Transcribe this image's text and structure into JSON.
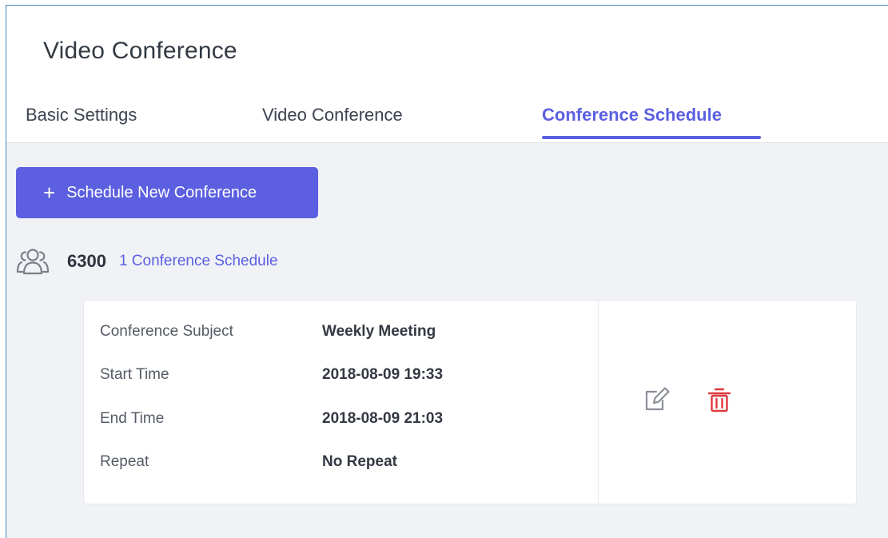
{
  "page": {
    "title": "Video Conference"
  },
  "tabs": [
    {
      "label": "Basic Settings",
      "active": false
    },
    {
      "label": "Video Conference",
      "active": false
    },
    {
      "label": "Conference Schedule",
      "active": true
    }
  ],
  "toolbar": {
    "new_button_icon": "plus-icon",
    "new_button_label": "Schedule New Conference"
  },
  "room": {
    "icon": "conference-users-icon",
    "number": "6300",
    "schedule_count_label": "1 Conference Schedule"
  },
  "schedule": {
    "rows": [
      {
        "label": "Conference Subject",
        "value": "Weekly Meeting"
      },
      {
        "label": "Start Time",
        "value": "2018-08-09 19:33"
      },
      {
        "label": "End Time",
        "value": "2018-08-09 21:03"
      },
      {
        "label": "Repeat",
        "value": "No Repeat"
      }
    ],
    "actions": {
      "edit_icon": "edit-icon",
      "delete_icon": "trash-icon"
    }
  },
  "colors": {
    "accent": "#5b5fe0",
    "delete": "#e0393e",
    "edit": "#8a8f99",
    "content_bg": "#f0f2f6"
  }
}
